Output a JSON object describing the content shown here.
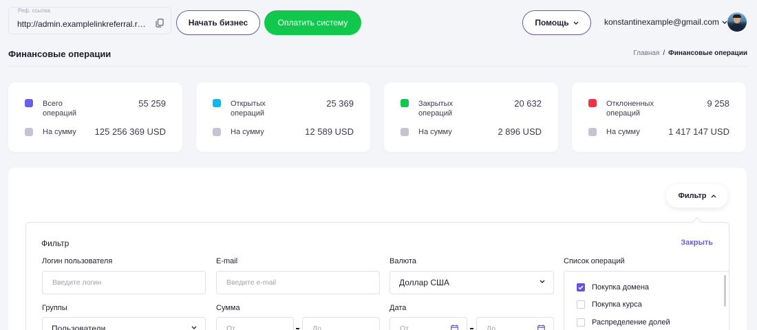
{
  "topbar": {
    "ref_label": "Реф. ссылка",
    "ref_value": "http://admin.examplelinkreferral.re...",
    "start_business": "Начать бизнес",
    "pay_system": "Оплатить систему",
    "help": "Помощь",
    "user_email": "konstantinexample@gmail.com"
  },
  "page": {
    "title": "Финансовые операции",
    "breadcrumb": {
      "home": "Главная",
      "separator": "/",
      "current": "Финансовые операции"
    }
  },
  "stats": [
    {
      "label": "Всего операций",
      "value": "55 259",
      "sum_label": "На сумму",
      "sum_value": "125 256 369 USD",
      "color": "#6a5fe6"
    },
    {
      "label": "Открытых операций",
      "value": "25 369",
      "sum_label": "На сумму",
      "sum_value": "12 589 USD",
      "color": "#13b6e8"
    },
    {
      "label": "Закрытых операций",
      "value": "20 632",
      "sum_label": "На сумму",
      "sum_value": "2 896 USD",
      "color": "#11c84c"
    },
    {
      "label": "Отклоненных операций",
      "value": "9 258",
      "sum_label": "На сумму",
      "sum_value": "1 417 147 USD",
      "color": "#ec3446"
    }
  ],
  "filter": {
    "toggle_label": "Фильтр",
    "title": "Фильтр",
    "close": "Закрыть",
    "login_label": "Логин пользователя",
    "login_placeholder": "Введите логин",
    "email_label": "E-mail",
    "email_placeholder": "Введите e-mail",
    "currency_label": "Валюта",
    "currency_value": "Доллар США",
    "operations_label": "Список операций",
    "operations": [
      {
        "label": "Покупка домена",
        "checked": true
      },
      {
        "label": "Покупка курса",
        "checked": false
      },
      {
        "label": "Распределение долей",
        "checked": false
      }
    ],
    "groups_label": "Группы",
    "groups_value": "Пользователи",
    "amount_label": "Сумма",
    "amount_from_placeholder": "От",
    "amount_to_placeholder": "До",
    "date_label": "Дата",
    "date_from_placeholder": "От",
    "date_to_placeholder": "До"
  },
  "colors": {
    "accent": "#6257d6",
    "green": "#11c84c",
    "neutral_swatch": "#c4c5d0"
  }
}
